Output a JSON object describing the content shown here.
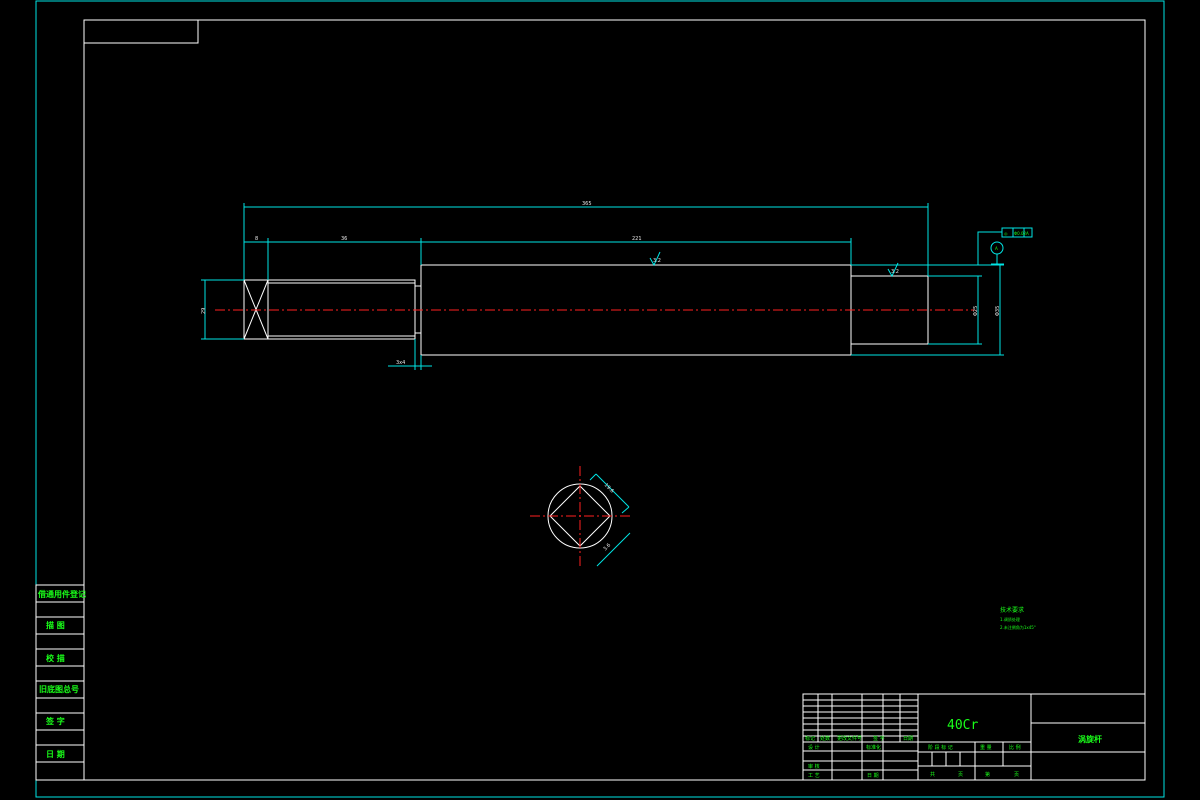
{
  "drawing": {
    "title": "涡旋杆",
    "material": "40Cr"
  },
  "dimensions": {
    "overall_length": "365",
    "left_hex_length": "8",
    "thread_length": "36",
    "main_length": "221",
    "left_height": "29",
    "neck": "3x4",
    "right_dia": "Φ25",
    "main_dia": "Φ35",
    "surface_main": "3.2",
    "surface_end": "3.2",
    "section_flat_1": "19.6",
    "section_flat_2": "3.6"
  },
  "tolerance": {
    "symbol": "◎",
    "value": "Φ0.02",
    "datum": "A",
    "datum_label": "A"
  },
  "tech_requirements": {
    "title": "技术要求",
    "lines": [
      "1.调质处理",
      "2.未注倒角为1x45°"
    ]
  },
  "left_strip": {
    "items": [
      "借通用件登记",
      "描 图",
      "校 描",
      "旧底图总号",
      "签 字",
      "日 期"
    ]
  },
  "title_block": {
    "headers": [
      "标记",
      "处数",
      "更改文件号",
      "签 字",
      "日期"
    ],
    "rows": [
      "设 计",
      "审 核",
      "工 艺"
    ],
    "standardize": "标准化",
    "date_label": "日 期",
    "stage_mark": "阶 段 标 记",
    "weight": "重 量",
    "scale": "比 例",
    "sheets": "共",
    "sheet_unit": "页",
    "sheet_no": "第",
    "sheet_unit2": "页"
  }
}
